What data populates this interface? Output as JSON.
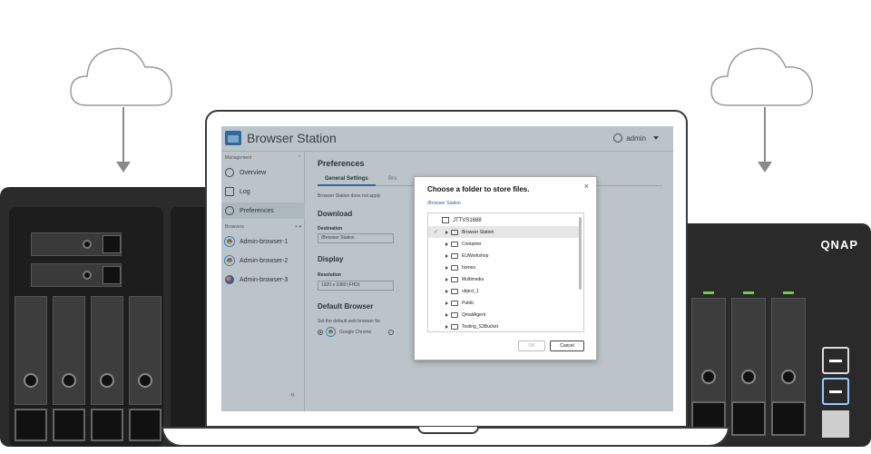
{
  "app": {
    "title": "Browser Station",
    "user": "admin"
  },
  "brand": "QNAP",
  "sidebar": {
    "management_label": "Management",
    "browsers_label": "Browsers",
    "items": [
      {
        "label": "Overview",
        "icon": "overview-icon"
      },
      {
        "label": "Log",
        "icon": "log-icon"
      },
      {
        "label": "Preferences",
        "icon": "gear-icon",
        "active": true
      }
    ],
    "browsers": [
      {
        "label": "Admin-browser-1",
        "icon": "chrome-icon"
      },
      {
        "label": "Admin-browser-2",
        "icon": "chrome-icon"
      },
      {
        "label": "Admin-browser-3",
        "icon": "firefox-icon"
      }
    ],
    "collapse_symbol": "«"
  },
  "content": {
    "title": "Preferences",
    "tabs": [
      {
        "label": "General Settings",
        "active": true
      },
      {
        "label": "Bro",
        "active": false
      }
    ],
    "note": "Browser Station does not apply",
    "download_heading": "Download",
    "destination_label": "Destination",
    "destination_value": "/Browser Station",
    "display_heading": "Display",
    "resolution_label": "Resolution",
    "resolution_value": "1920 x 1080 (FHD)",
    "default_browser_heading": "Default Browser",
    "default_browser_note": "Set the default web browser for",
    "default_browser_option": "Google Chrome"
  },
  "modal": {
    "title": "Choose a folder to store files.",
    "close": "×",
    "path": "/Browser Station",
    "root": "JTTVS1688",
    "folders": [
      {
        "label": "Browser Station",
        "selected": true
      },
      {
        "label": "Container",
        "selected": false
      },
      {
        "label": "EUWorkshop",
        "selected": false
      },
      {
        "label": "homes",
        "selected": false
      },
      {
        "label": "Multimedia",
        "selected": false
      },
      {
        "label": "object_1",
        "selected": false
      },
      {
        "label": "Public",
        "selected": false
      },
      {
        "label": "QmailAgent",
        "selected": false
      },
      {
        "label": "Testing_S3Bucket",
        "selected": false
      }
    ],
    "check": "✓",
    "ok_label": "OK",
    "cancel_label": "Cancel"
  },
  "colors": {
    "accent": "#2c6fb5",
    "led": "#6ad04a",
    "chrome_red": "#e8453c",
    "firefox_blue": "#3a57c4"
  }
}
